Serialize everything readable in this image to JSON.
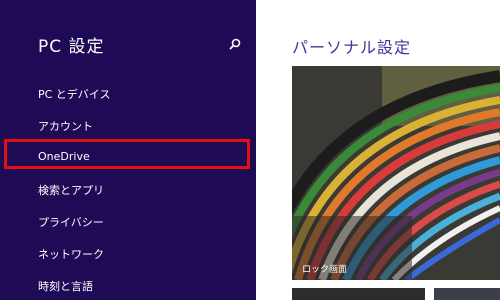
{
  "sidebar": {
    "title": "PC 設定",
    "items": [
      {
        "label": "PC とデバイス"
      },
      {
        "label": "アカウント"
      },
      {
        "label": "OneDrive",
        "selected": true
      },
      {
        "label": "検索とアプリ"
      },
      {
        "label": "プライバシー"
      },
      {
        "label": "ネットワーク"
      },
      {
        "label": "時刻と言語"
      }
    ]
  },
  "main": {
    "title": "パーソナル設定",
    "tile_label": "ロック画面"
  },
  "colors": {
    "sidebar_bg": "#1e0a55",
    "accent": "#4a2f9a",
    "highlight": "#e01010"
  },
  "icons": {
    "search": "search-icon"
  }
}
